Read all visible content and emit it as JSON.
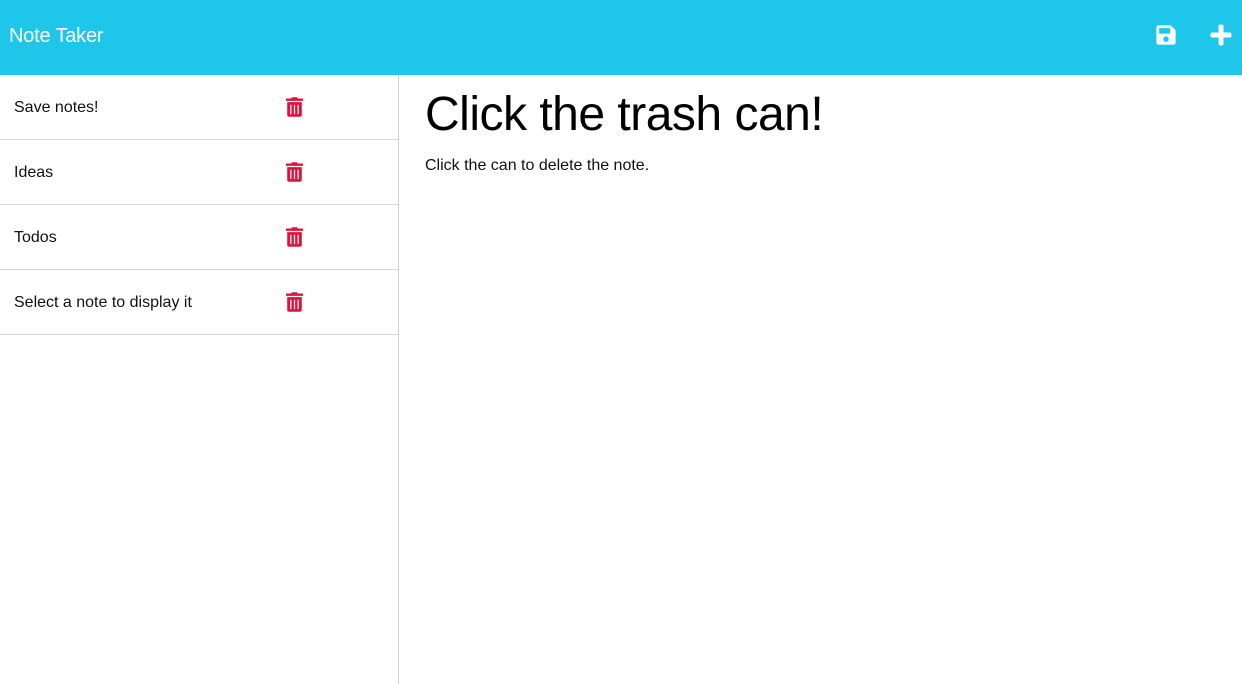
{
  "header": {
    "title": "Note Taker",
    "save_icon": "floppy-disk-icon",
    "new_icon": "plus-icon",
    "background_color": "#1ec6ea"
  },
  "sidebar": {
    "notes": [
      {
        "title": "Save notes!",
        "delete_icon": "trash-icon"
      },
      {
        "title": "Ideas",
        "delete_icon": "trash-icon"
      },
      {
        "title": "Todos",
        "delete_icon": "trash-icon"
      },
      {
        "title": "Select a note to display it",
        "delete_icon": "trash-icon"
      }
    ],
    "delete_icon_color": "#dc143c"
  },
  "main": {
    "note_title": "Click the trash can!",
    "note_text": "Click the can to delete the note."
  }
}
